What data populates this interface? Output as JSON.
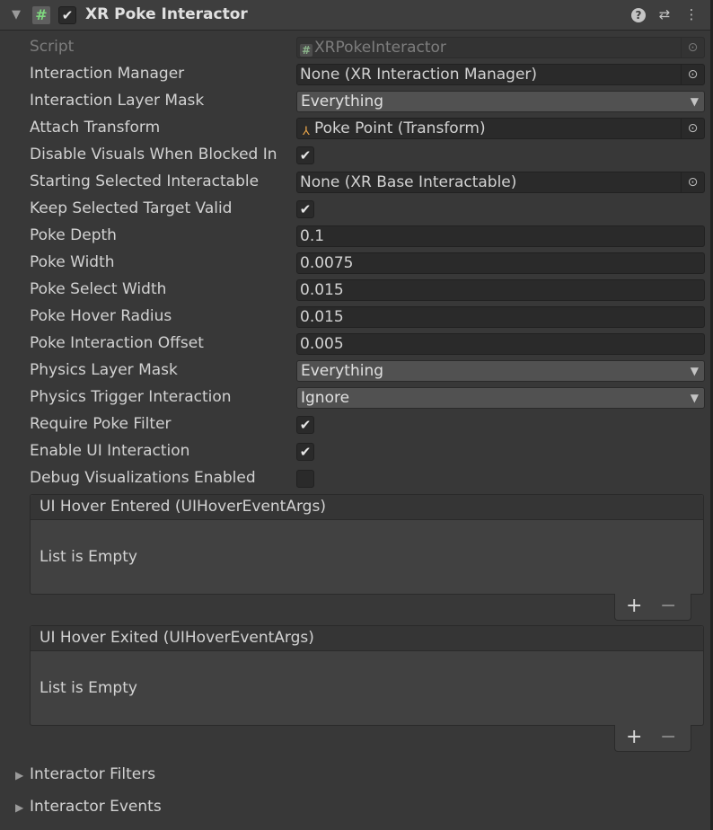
{
  "header": {
    "title": "XR Poke Interactor",
    "enabled": true,
    "icons": [
      "foldout-arrow",
      "script-icon",
      "help-icon",
      "presets-icon",
      "more-icon"
    ]
  },
  "fields": {
    "script": {
      "label": "Script",
      "value": "XRPokeInteractor"
    },
    "interaction_manager": {
      "label": "Interaction Manager",
      "value": "None (XR Interaction Manager)"
    },
    "interaction_layer_mask": {
      "label": "Interaction Layer Mask",
      "value": "Everything"
    },
    "attach_transform": {
      "label": "Attach Transform",
      "value": "Poke Point (Transform)"
    },
    "disable_visuals": {
      "label": "Disable Visuals When Blocked In",
      "checked": true
    },
    "starting_selected": {
      "label": "Starting Selected Interactable",
      "value": "None (XR Base Interactable)"
    },
    "keep_selected": {
      "label": "Keep Selected Target Valid",
      "checked": true
    },
    "poke_depth": {
      "label": "Poke Depth",
      "value": "0.1"
    },
    "poke_width": {
      "label": "Poke Width",
      "value": "0.0075"
    },
    "poke_select_width": {
      "label": "Poke Select Width",
      "value": "0.015"
    },
    "poke_hover_radius": {
      "label": "Poke Hover Radius",
      "value": "0.015"
    },
    "poke_interaction_offset": {
      "label": "Poke Interaction Offset",
      "value": "0.005"
    },
    "physics_layer_mask": {
      "label": "Physics Layer Mask",
      "value": "Everything"
    },
    "physics_trigger": {
      "label": "Physics Trigger Interaction",
      "value": "Ignore"
    },
    "require_poke_filter": {
      "label": "Require Poke Filter",
      "checked": true
    },
    "enable_ui_interaction": {
      "label": "Enable UI Interaction",
      "checked": true
    },
    "debug_visualizations": {
      "label": "Debug Visualizations Enabled",
      "checked": false
    }
  },
  "events": [
    {
      "title": "UI Hover Entered (UIHoverEventArgs)",
      "empty_text": "List is Empty"
    },
    {
      "title": "UI Hover Exited (UIHoverEventArgs)",
      "empty_text": "List is Empty"
    }
  ],
  "list_buttons": {
    "add": "+",
    "remove": "−"
  },
  "foldouts": {
    "filters": "Interactor Filters",
    "events": "Interactor Events"
  },
  "glyphs": {
    "check": "✔",
    "dropdown_arrow": "▼",
    "picker": "⊙",
    "collapsed": "▶",
    "expanded": "▼",
    "script": "#",
    "help": "?",
    "presets": "⇄",
    "more": "⋮"
  }
}
